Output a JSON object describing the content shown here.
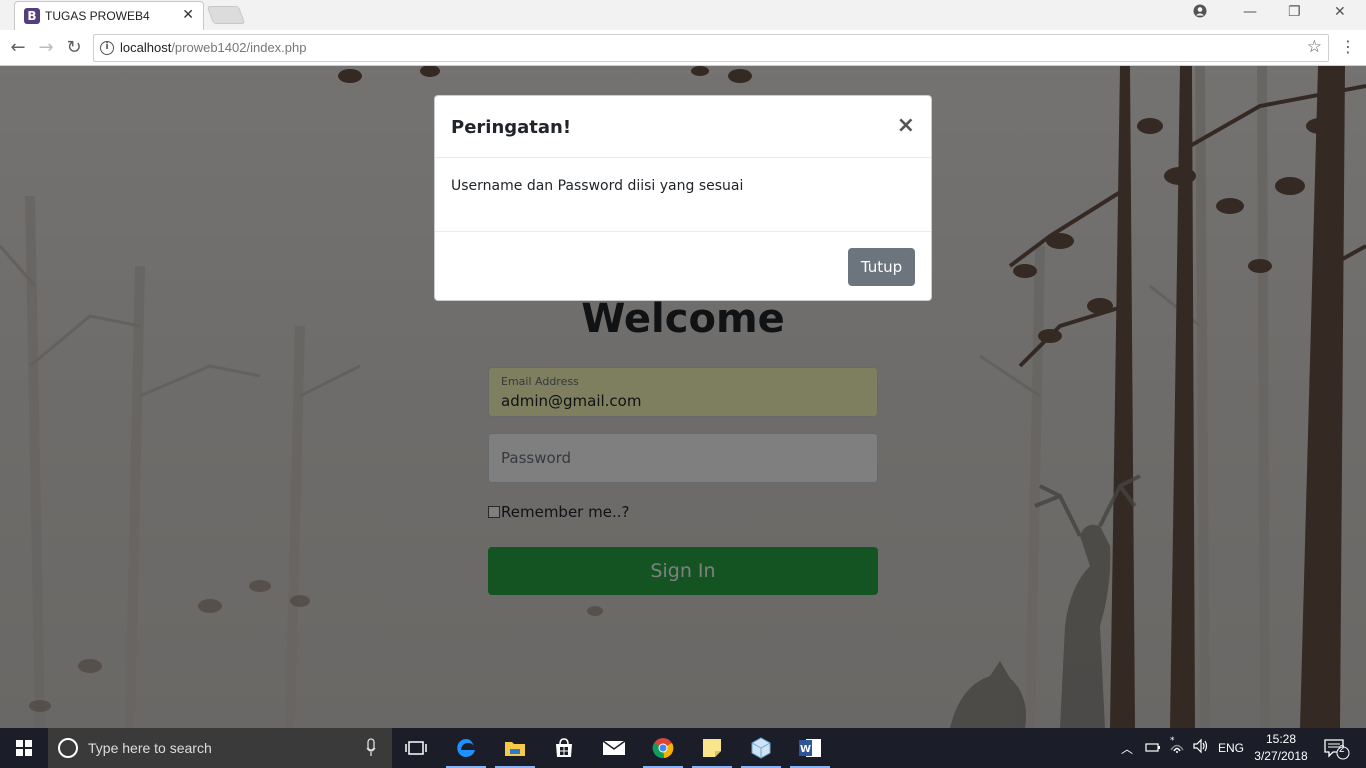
{
  "browser": {
    "tab_title": "TUGAS PROWEB4",
    "favicon_letter": "B",
    "url_host": "localhost",
    "url_path": "/proweb1402/index.php"
  },
  "login": {
    "heading": "Welcome",
    "email_label": "Email Address",
    "email_value": "admin@gmail.com",
    "password_placeholder": "Password",
    "remember_label": "Remember me..?",
    "signin_label": "Sign In"
  },
  "modal": {
    "title": "Peringatan!",
    "close_symbol": "×",
    "message": "Username dan Password diisi yang sesuai",
    "close_button": "Tutup"
  },
  "taskbar": {
    "search_placeholder": "Type here to search",
    "language": "ENG",
    "time": "15:28",
    "date": "3/27/2018",
    "notification_count": "2"
  },
  "colors": {
    "modal_button": "#6c757d",
    "signin_button": "#28a745",
    "autofill_background": "#faffbd",
    "favicon": "#563d7c"
  }
}
